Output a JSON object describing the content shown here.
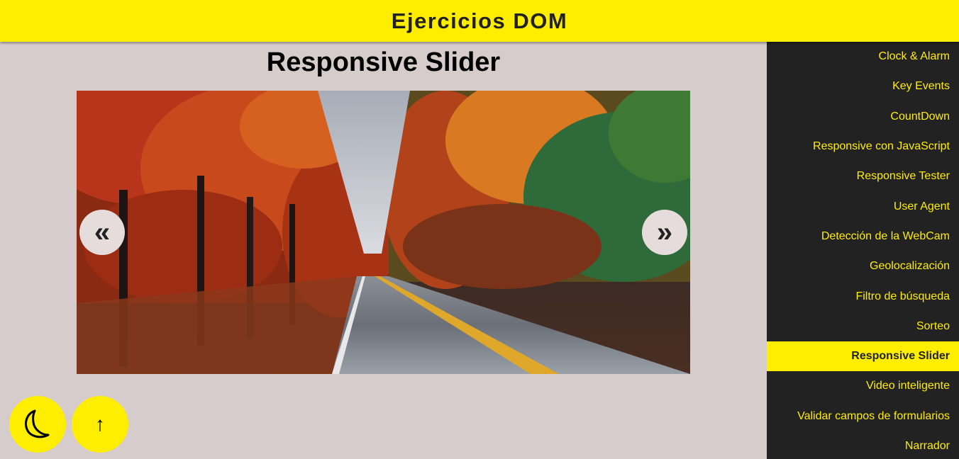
{
  "header": {
    "title": "Ejercicios DOM"
  },
  "section": {
    "title": "Responsive Slider"
  },
  "slider": {
    "prev_label": "«",
    "next_label": "»",
    "image_icon": "autumn-road-photo"
  },
  "floating_buttons": {
    "dark_mode_icon": "moon-icon",
    "scroll_top_label": "↑"
  },
  "menu": {
    "active_index": 10,
    "items": [
      {
        "label": "Clock & Alarm"
      },
      {
        "label": "Key Events"
      },
      {
        "label": "CountDown"
      },
      {
        "label": "Responsive con JavaScript"
      },
      {
        "label": "Responsive Tester"
      },
      {
        "label": "User Agent"
      },
      {
        "label": "Detección de la WebCam"
      },
      {
        "label": "Geolocalización"
      },
      {
        "label": "Filtro de búsqueda"
      },
      {
        "label": "Sorteo"
      },
      {
        "label": "Responsive Slider"
      },
      {
        "label": "Video inteligente"
      },
      {
        "label": "Validar campos de formularios"
      },
      {
        "label": "Narrador"
      }
    ]
  },
  "colors": {
    "accent": "#ffee00",
    "menu_bg": "#222222",
    "page_bg": "#d6cccc"
  }
}
